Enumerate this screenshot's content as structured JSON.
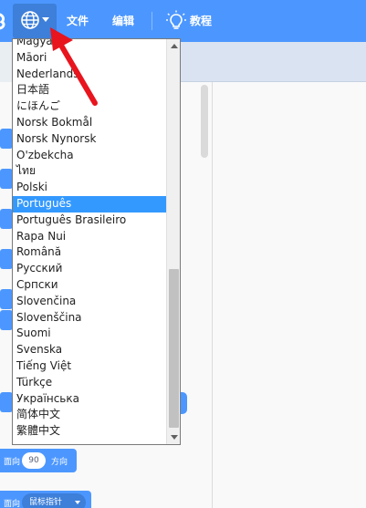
{
  "menubar": {
    "file": "文件",
    "edit": "编辑",
    "tutorials": "教程"
  },
  "languages": {
    "selected": "Português",
    "items": [
      "Magyar",
      "Māori",
      "Nederlands",
      "日本語",
      "にほんご",
      "Norsk Bokmål",
      "Norsk Nynorsk",
      "O'zbekcha",
      "ไทย",
      "Polski",
      "Português",
      "Português Brasileiro",
      "Rapa Nui",
      "Română",
      "Русский",
      "Српски",
      "Slovenčina",
      "Slovenščina",
      "Suomi",
      "Svenska",
      "Tiếng Việt",
      "Türkçe",
      "Українська",
      "简体中文",
      "繁體中文"
    ]
  },
  "blocks": {
    "point_in_direction_value": "90",
    "point_in_direction_suffix": "方向",
    "point_in_direction_prefix": "面向",
    "point_towards_prefix": "面向",
    "point_towards_value": "鼠标指针"
  },
  "colors": {
    "menubar": "#4c97ff",
    "selection": "#3399ff",
    "arrow": "#e8141e"
  }
}
